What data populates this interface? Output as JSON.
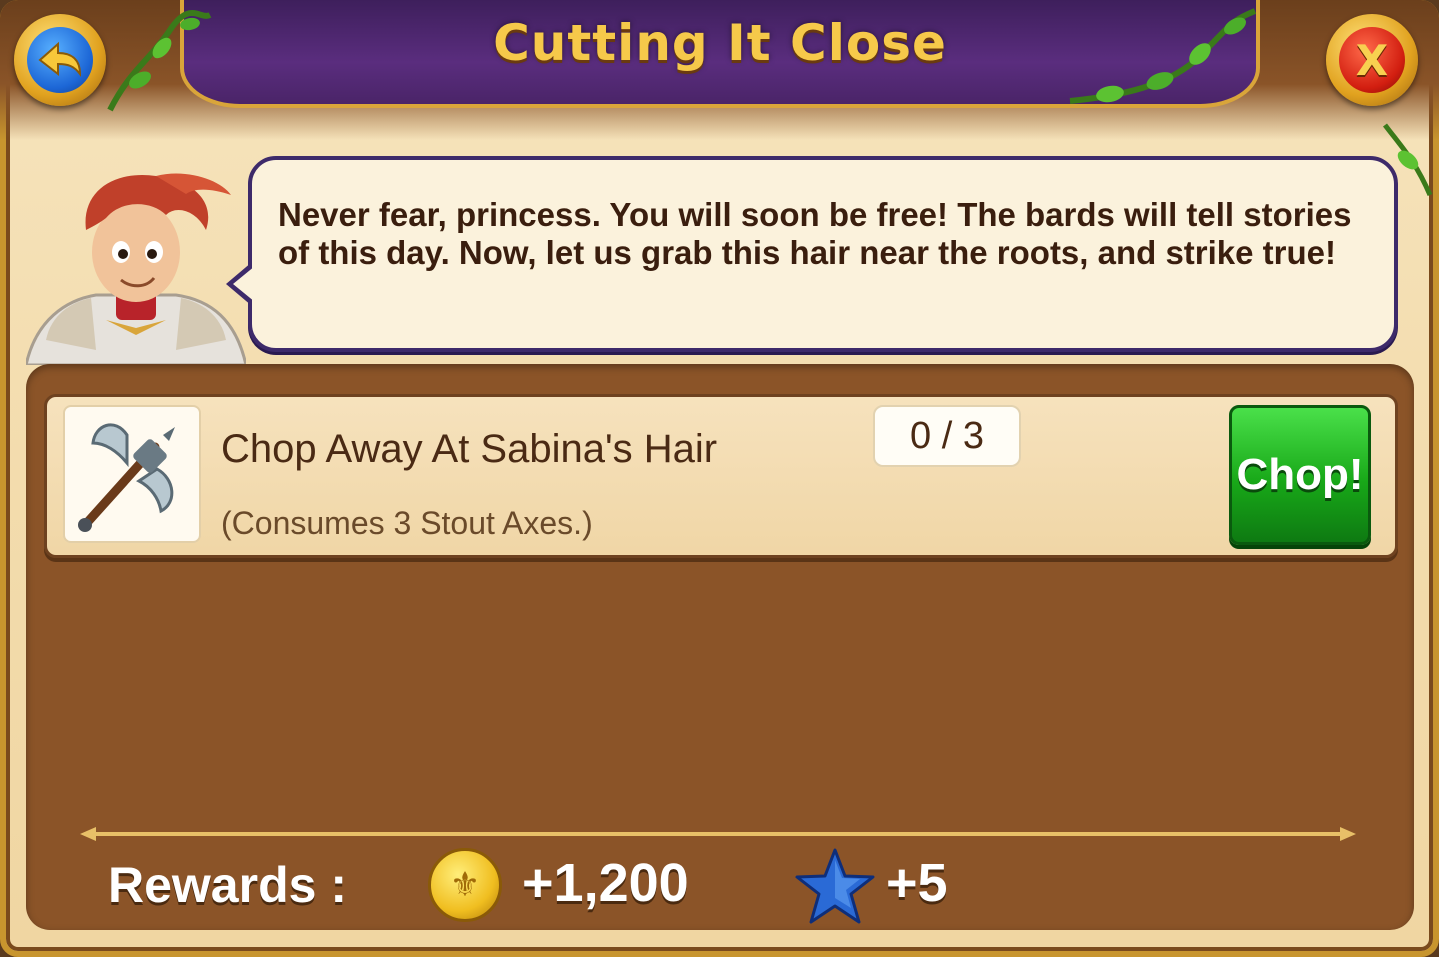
{
  "dialog": {
    "title": "Cutting It Close",
    "back_icon": "back-arrow-icon",
    "close_label": "X"
  },
  "speech": {
    "text": "Never fear, princess. You will soon be free! The bards will tell stories of this day. Now, let us grab this hair near the roots, and strike true!"
  },
  "task": {
    "title": "Chop Away At Sabina's Hair",
    "subtitle": "(Consumes 3 Stout Axes.)",
    "progress": "0 / 3",
    "progress_current": 0,
    "progress_total": 3,
    "action_label": "Chop!",
    "icon": "battle-axe-icon"
  },
  "rewards": {
    "label": "Rewards :",
    "coins": "+1,200",
    "coin_icon": "gold-coin-icon",
    "xp": "+5",
    "xp_icon": "blue-star-icon"
  },
  "colors": {
    "title_text": "#f6c94a",
    "banner": "#4a2468",
    "panel": "#8b5428",
    "chop_button": "#18a818"
  }
}
